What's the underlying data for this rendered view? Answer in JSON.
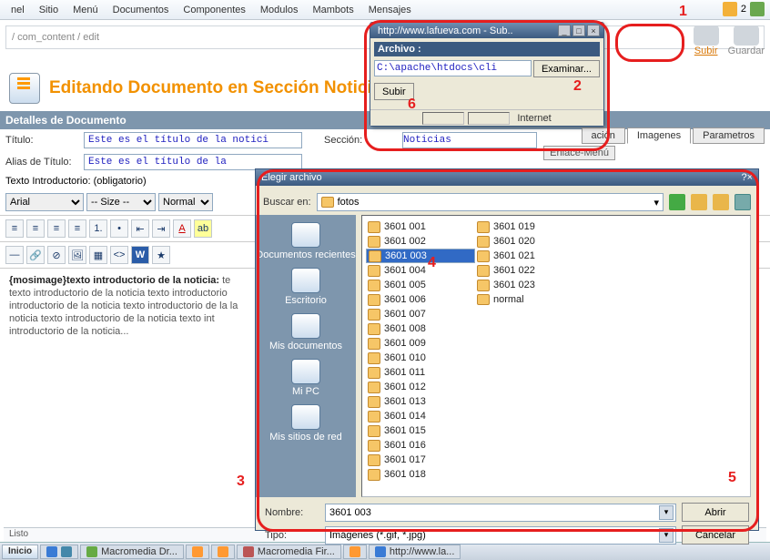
{
  "menu": [
    "nel",
    "Sitio",
    "Menú",
    "Documentos",
    "Componentes",
    "Modulos",
    "Mambots",
    "Mensajes"
  ],
  "top_counter": "2",
  "breadcrumb": "/ com_content / edit",
  "actions": {
    "subir": "Subir",
    "guardar": "Guardar"
  },
  "heading": "Editando Documento en Sección Noticia",
  "section_title": "Detalles de Documento",
  "form": {
    "titulo_label": "Título:",
    "titulo_value": "Este es el título de la notici",
    "alias_label": "Alias de Título:",
    "alias_value": "Este es el título de la",
    "seccion_label": "Sección:",
    "seccion_value": "Noticias",
    "intro_label": "Texto Introductorio: (obligatorio)"
  },
  "tabs": {
    "acion": "ación",
    "imagenes": "Imagenes",
    "parametros": "Parametros",
    "enlace": "Enlace-Menú"
  },
  "editor": {
    "font": "Arial",
    "size": "-- Size --",
    "format": "Normal",
    "content_bold": "{mosimage}texto introductorio de la noticia:",
    "content_rest": " te\ntexto introductorio de la noticia texto introductorio\nintroductorio de la noticia texto introductorio de la\nla noticia texto introductorio de la noticia texto int\nintroductorio de la noticia..."
  },
  "status_text": "Listo",
  "taskbar": {
    "start": "Inicio",
    "items": [
      "Macromedia Dr...",
      "",
      "",
      "Macromedia Fir...",
      "",
      "http://www.la..."
    ]
  },
  "popup": {
    "title": "http://www.lafueva.com - Sub..",
    "label": "Archivo :",
    "path": "C:\\apache\\htdocs\\cli",
    "browse": "Examinar...",
    "submit": "Subir",
    "status": "Internet"
  },
  "filedlg": {
    "title": "Elegir archivo",
    "lookin_label": "Buscar en:",
    "folder": "fotos",
    "places": [
      "Documentos recientes",
      "Escritorio",
      "Mis documentos",
      "Mi PC",
      "Mis sitios de red"
    ],
    "files_col1": [
      "3601 001",
      "3601 002",
      "3601 003",
      "3601 004",
      "3601 005",
      "3601 006",
      "3601 007",
      "3601 008",
      "3601 009",
      "3601 010",
      "3601 011",
      "3601 012",
      "3601 013",
      "3601 014",
      "3601 015"
    ],
    "files_col2": [
      "3601 016",
      "3601 017",
      "3601 018",
      "3601 019",
      "3601 020",
      "3601 021",
      "3601 022",
      "3601 023",
      "normal"
    ],
    "selected_index": 2,
    "name_label": "Nombre:",
    "name_value": "3601 003",
    "type_label": "Tipo:",
    "type_value": "Imágenes (*.gif, *.jpg)",
    "open": "Abrir",
    "cancel": "Cancelar"
  },
  "annotations": {
    "n1": "1",
    "n2": "2",
    "n3": "3",
    "n4": "4",
    "n5": "5",
    "n6": "6"
  }
}
